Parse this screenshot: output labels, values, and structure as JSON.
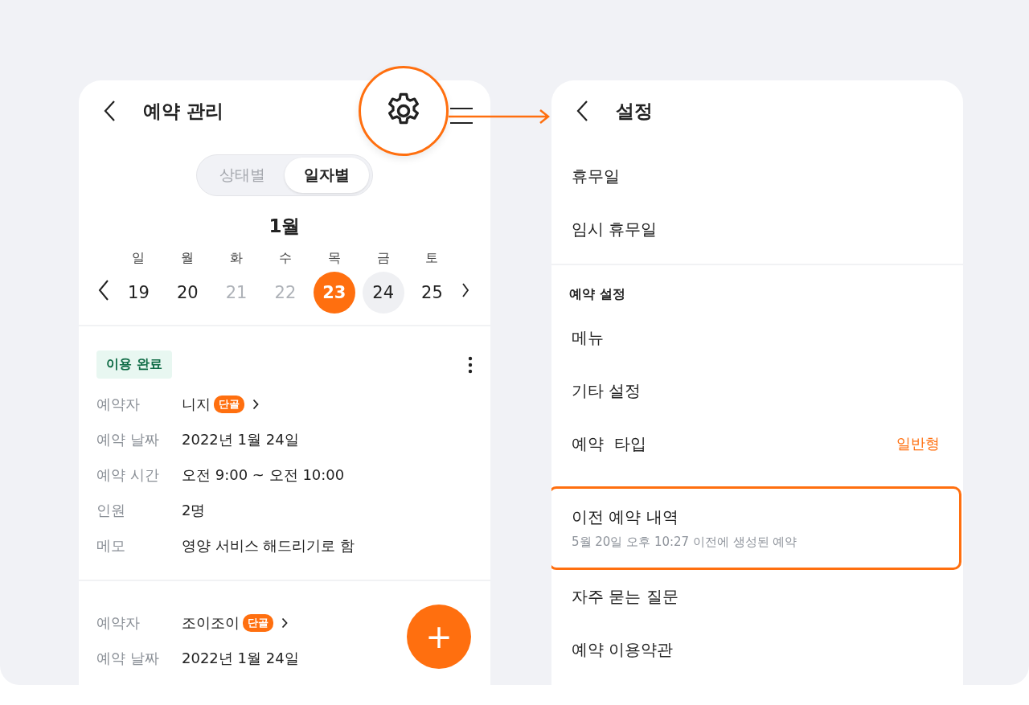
{
  "left_screen": {
    "title": "예약 관리",
    "segments": [
      {
        "label": "상태별",
        "selected": false
      },
      {
        "label": "일자별",
        "selected": true
      }
    ],
    "month": "1월",
    "days": [
      {
        "weekday": "일",
        "date": "19",
        "selected": false,
        "disabled": false,
        "highlighted": false
      },
      {
        "weekday": "월",
        "date": "20",
        "selected": false,
        "disabled": false,
        "highlighted": false
      },
      {
        "weekday": "화",
        "date": "21",
        "selected": false,
        "disabled": true,
        "highlighted": false
      },
      {
        "weekday": "수",
        "date": "22",
        "selected": false,
        "disabled": true,
        "highlighted": false
      },
      {
        "weekday": "목",
        "date": "23",
        "selected": true,
        "disabled": false,
        "highlighted": false
      },
      {
        "weekday": "금",
        "date": "24",
        "selected": false,
        "disabled": false,
        "highlighted": true
      },
      {
        "weekday": "토",
        "date": "25",
        "selected": false,
        "disabled": false,
        "highlighted": false
      }
    ],
    "reservations": [
      {
        "status": "이용 완료",
        "fields": [
          {
            "label": "예약자",
            "kind": "person",
            "value": "니지",
            "tag": "단골"
          },
          {
            "label": "예약 날짜",
            "kind": "text",
            "value": "2022년 1월 24일"
          },
          {
            "label": "예약 시간",
            "kind": "text",
            "value": "오전 9:00 ~ 오전 10:00"
          },
          {
            "label": "인원",
            "kind": "text",
            "value": "2명"
          },
          {
            "label": "메모",
            "kind": "text",
            "value": "영양 서비스 해드리기로 함"
          }
        ]
      },
      {
        "fields": [
          {
            "label": "예약자",
            "kind": "person",
            "value": "조이조이",
            "tag": "단골"
          },
          {
            "label": "예약 날짜",
            "kind": "text",
            "value": "2022년 1월 24일"
          }
        ]
      }
    ],
    "fab": "+"
  },
  "right_screen": {
    "title": "설정",
    "groups": [
      {
        "items": [
          {
            "label": "휴무일",
            "highlighted": false
          },
          {
            "label": "임시 휴무일",
            "highlighted": false
          }
        ]
      },
      {
        "header": "예약 설정",
        "items": [
          {
            "label": "메뉴",
            "highlighted": false
          },
          {
            "label": "기타 설정",
            "highlighted": false
          },
          {
            "label": "예약  타입",
            "value": "일반형",
            "highlighted": false
          },
          {
            "label": "이전 예약 내역",
            "subtitle": "5월 20일 오후 10:27 이전에 생성된 예약",
            "highlighted": true
          },
          {
            "label": "자주 묻는 질문",
            "highlighted": false
          },
          {
            "label": "예약 이용약관",
            "highlighted": false
          }
        ]
      }
    ]
  }
}
